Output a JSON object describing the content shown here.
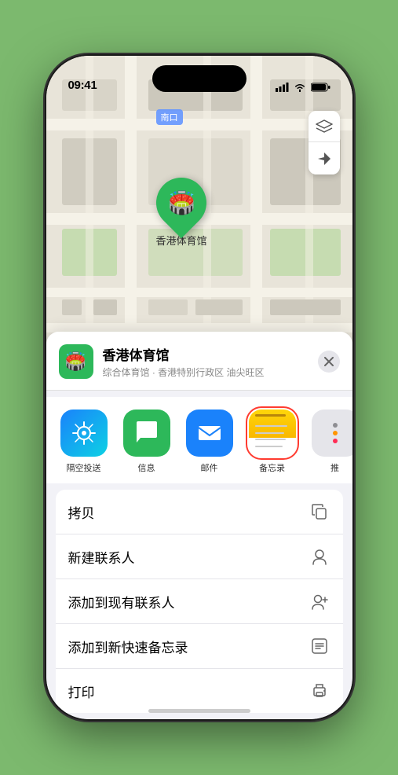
{
  "status_bar": {
    "time": "09:41",
    "location_arrow": true
  },
  "map": {
    "label_text": "南口",
    "pin_label": "香港体育馆",
    "controls": [
      "map-layers-icon",
      "location-arrow-icon"
    ]
  },
  "place_card": {
    "name": "香港体育馆",
    "subtitle": "综合体育馆 · 香港特别行政区 油尖旺区",
    "close_label": "×"
  },
  "share_items": [
    {
      "id": "airdrop",
      "label": "隔空投送",
      "type": "airdrop"
    },
    {
      "id": "messages",
      "label": "信息",
      "type": "messages"
    },
    {
      "id": "mail",
      "label": "邮件",
      "type": "mail"
    },
    {
      "id": "notes",
      "label": "备忘录",
      "type": "notes",
      "selected": true
    },
    {
      "id": "more",
      "label": "推",
      "type": "more"
    }
  ],
  "actions": [
    {
      "label": "拷贝",
      "icon": "copy"
    },
    {
      "label": "新建联系人",
      "icon": "person-add"
    },
    {
      "label": "添加到现有联系人",
      "icon": "person-plus"
    },
    {
      "label": "添加到新快速备忘录",
      "icon": "note-add"
    },
    {
      "label": "打印",
      "icon": "printer"
    }
  ]
}
